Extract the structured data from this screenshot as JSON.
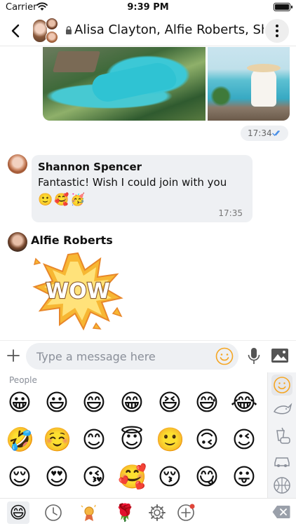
{
  "status_bar": {
    "carrier": "Carrier",
    "time": "9:39 PM"
  },
  "header": {
    "title": "Alisa Clayton, Alfie Roberts, Shannon Spencer"
  },
  "messages": {
    "photo_time": "17:34",
    "shannon": {
      "sender": "Shannon Spencer",
      "text": "Fantastic! Wish I could join with you",
      "reactions": "🙂🥰🥳",
      "time": "17:35"
    },
    "alfie": {
      "sender": "Alfie Roberts",
      "sticker_text": "WOW"
    }
  },
  "composer": {
    "placeholder": "Type a message here"
  },
  "emoji_panel": {
    "section_label": "People",
    "rows": [
      [
        "😀",
        "😃",
        "😄",
        "😁",
        "😆",
        "😅",
        "😂"
      ],
      [
        "🤣",
        "☺️",
        "😊",
        "😇",
        "🙂",
        "🙃",
        "😉"
      ],
      [
        "😌",
        "😍",
        "😘",
        "🥰",
        "😚",
        "😋",
        "😛"
      ]
    ],
    "categories": [
      "smiley-icon",
      "animal-icon",
      "food-icon",
      "car-icon",
      "ball-icon"
    ],
    "tabs": {
      "active_emoji": "😄",
      "rose": "🌹"
    }
  },
  "colors": {
    "accent": "#f5a623",
    "bubble": "#eef0f3",
    "read_ticks": "#4a8fe7"
  }
}
